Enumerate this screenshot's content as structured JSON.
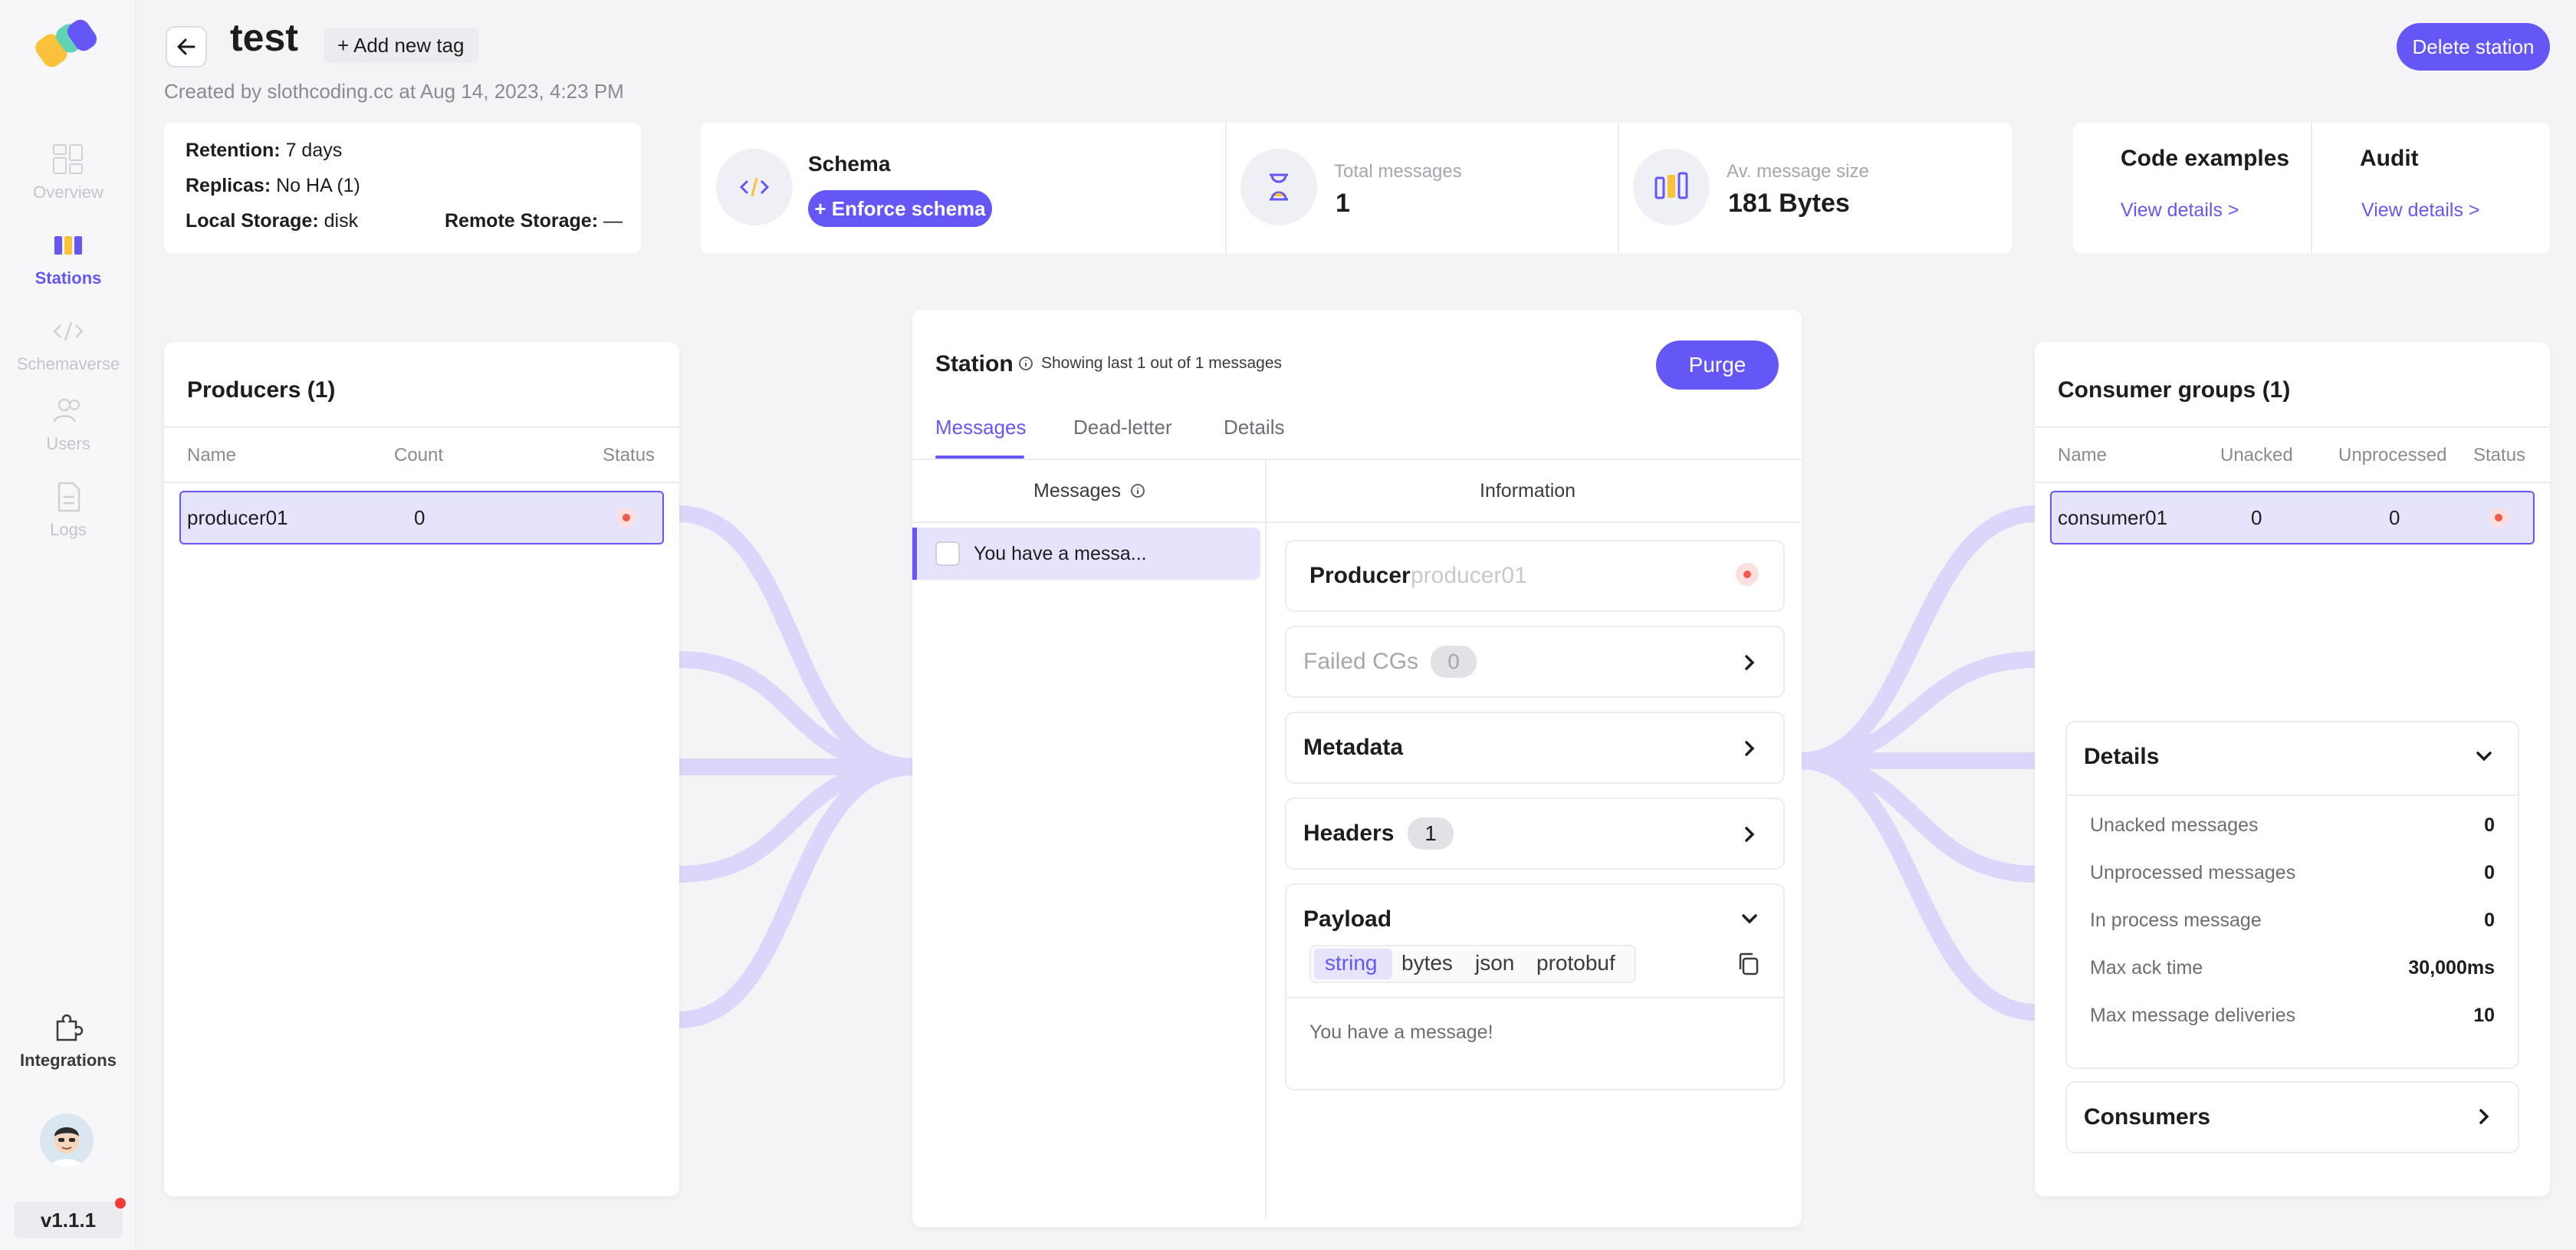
{
  "sidebar": {
    "items": [
      {
        "label": "Overview",
        "icon": "overview-icon"
      },
      {
        "label": "Stations",
        "icon": "stations-icon",
        "active": true
      },
      {
        "label": "Schemaverse",
        "icon": "code-icon"
      },
      {
        "label": "Users",
        "icon": "users-icon"
      },
      {
        "label": "Logs",
        "icon": "logs-icon"
      }
    ],
    "integrations": "Integrations",
    "version": "v1.1.1"
  },
  "header": {
    "title": "test",
    "add_tag": "+ Add new tag",
    "created": "Created by slothcoding.cc at Aug 14, 2023, 4:23 PM",
    "delete": "Delete station"
  },
  "info": {
    "retention_label": "Retention:",
    "retention_value": "7 days",
    "replicas_label": "Replicas:",
    "replicas_value": "No HA (1)",
    "local_label": "Local Storage:",
    "local_value": "disk",
    "remote_label": "Remote Storage:",
    "remote_value": "—"
  },
  "stats": {
    "schema_label": "Schema",
    "enforce": "+ Enforce schema",
    "total_label": "Total messages",
    "total_value": "1",
    "avg_label": "Av. message size",
    "avg_value": "181 Bytes"
  },
  "links": {
    "code_title": "Code examples",
    "code_link": "View details >",
    "audit_title": "Audit",
    "audit_link": "View details >"
  },
  "producers": {
    "title": "Producers (1)",
    "cols": [
      "Name",
      "Count",
      "Status"
    ],
    "rows": [
      {
        "name": "producer01",
        "count": "0"
      }
    ]
  },
  "station": {
    "title": "Station",
    "subtitle": "Showing last 1 out of 1 messages",
    "purge": "Purge",
    "tabs": [
      "Messages",
      "Dead-letter",
      "Details"
    ],
    "col_messages": "Messages",
    "col_info": "Information",
    "message_item": "You have a messa...",
    "producer_label": "Producer",
    "producer_value": "producer01",
    "failed_label": "Failed CGs",
    "failed_count": "0",
    "metadata": "Metadata",
    "headers": "Headers",
    "headers_count": "1",
    "payload": "Payload",
    "payload_tabs": [
      "string",
      "bytes",
      "json",
      "protobuf"
    ],
    "payload_text": "You have a message!"
  },
  "consumers": {
    "title": "Consumer groups (1)",
    "cols": [
      "Name",
      "Unacked",
      "Unprocessed",
      "Status"
    ],
    "rows": [
      {
        "name": "consumer01",
        "unacked": "0",
        "unprocessed": "0"
      }
    ],
    "details_title": "Details",
    "details": [
      {
        "label": "Unacked messages",
        "value": "0"
      },
      {
        "label": "Unprocessed messages",
        "value": "0"
      },
      {
        "label": "In process message",
        "value": "0"
      },
      {
        "label": "Max ack time",
        "value": "30,000ms"
      },
      {
        "label": "Max message deliveries",
        "value": "10"
      }
    ],
    "consumers_label": "Consumers"
  },
  "colors": {
    "accent": "#6557f5",
    "danger": "#ef5a4a",
    "flow": "#d8d4fb"
  }
}
